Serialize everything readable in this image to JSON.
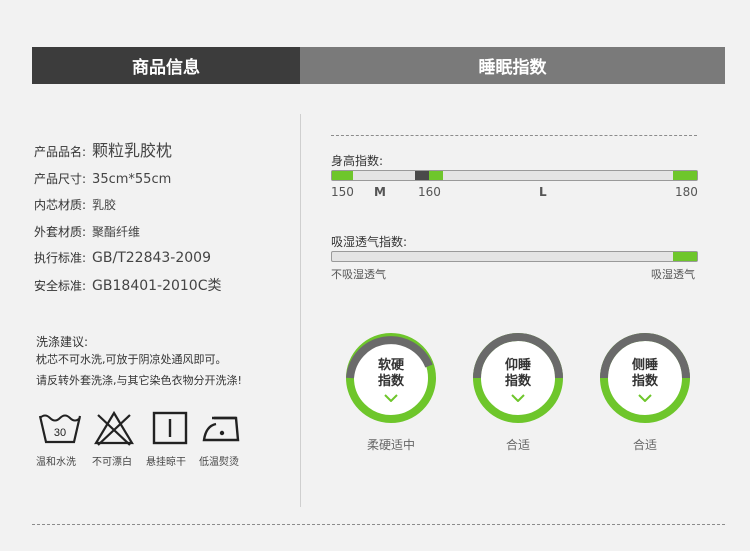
{
  "header": {
    "left": "商品信息",
    "right": "睡眠指数"
  },
  "specs": [
    {
      "label": "产品品名:",
      "value": "颗粒乳胶枕"
    },
    {
      "label": "产品尺寸:",
      "value": "35cm*55cm"
    },
    {
      "label": "内芯材质:",
      "value": "乳胶"
    },
    {
      "label": "外套材质:",
      "value": "聚酯纤维"
    },
    {
      "label": "执行标准:",
      "value": "GB/T22843-2009"
    },
    {
      "label": "安全标准:",
      "value": "GB18401-2010C类"
    }
  ],
  "care": {
    "title": "洗涤建议:",
    "lines": [
      "枕芯不可水洗,可放于阴凉处通风即可。",
      "请反转外套洗涤,与其它染色衣物分开洗涤!"
    ],
    "icons": [
      {
        "icon": "wash-30-icon",
        "label": "温和水洗",
        "temp": "30"
      },
      {
        "icon": "no-bleach-icon",
        "label": "不可漂白"
      },
      {
        "icon": "line-dry-icon",
        "label": "悬挂晾干"
      },
      {
        "icon": "iron-low-icon",
        "label": "低温熨烫"
      }
    ]
  },
  "height_index": {
    "title": "身高指数:",
    "labels": {
      "min": "150",
      "m": "M",
      "mid": "160",
      "l": "L",
      "max": "180"
    }
  },
  "moisture_index": {
    "title": "吸湿透气指数:",
    "left_label": "不吸湿透气",
    "right_label": "吸湿透气"
  },
  "gauges": [
    {
      "line1": "软硬",
      "line2": "指数",
      "caption": "柔硬适中"
    },
    {
      "line1": "仰睡",
      "line2": "指数",
      "caption": "合适"
    },
    {
      "line1": "侧睡",
      "line2": "指数",
      "caption": "合适"
    }
  ],
  "colors": {
    "accent": "#6ec62b",
    "dark": "#3c3c3c",
    "gray": "#7a7a7a"
  }
}
